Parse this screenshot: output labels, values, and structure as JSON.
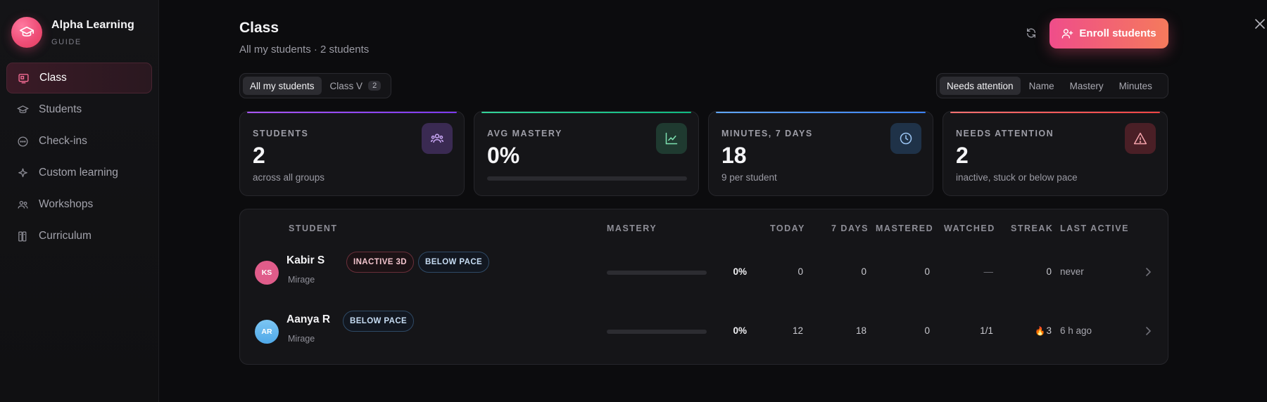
{
  "brand": {
    "name": "Alpha Learning",
    "subtitle": "GUIDE"
  },
  "nav": [
    {
      "label": "Class",
      "icon": "class-icon",
      "active": true
    },
    {
      "label": "Students",
      "icon": "graduation-cap-icon",
      "active": false
    },
    {
      "label": "Check-ins",
      "icon": "chat-bubble-icon",
      "active": false
    },
    {
      "label": "Custom learning",
      "icon": "sparkle-icon",
      "active": false
    },
    {
      "label": "Workshops",
      "icon": "people-icon",
      "active": false
    },
    {
      "label": "Curriculum",
      "icon": "book-icon",
      "active": false
    }
  ],
  "header": {
    "title": "Class",
    "subtitle": "All my students · 2 students",
    "enroll_label": "Enroll students"
  },
  "group_filter": [
    {
      "label": "All my students",
      "active": true
    },
    {
      "label": "Class V",
      "count": "2",
      "active": false
    }
  ],
  "sort_filter": [
    {
      "label": "Needs attention",
      "active": true
    },
    {
      "label": "Name",
      "active": false
    },
    {
      "label": "Mastery",
      "active": false
    },
    {
      "label": "Minutes",
      "active": false
    }
  ],
  "stats": [
    {
      "label": "STUDENTS",
      "value": "2",
      "note": "across all groups",
      "accent": "#a855f7",
      "icon": "group-icon"
    },
    {
      "label": "AVG MASTERY",
      "value": "0%",
      "progress": 0,
      "accent": "#34d399",
      "icon": "trend-chart-icon"
    },
    {
      "label": "MINUTES, 7 DAYS",
      "value": "18",
      "note": "9 per student",
      "accent": "#60a5fa",
      "icon": "clock-icon"
    },
    {
      "label": "NEEDS ATTENTION",
      "value": "2",
      "note": "inactive, stuck or below pace",
      "accent": "#f87171",
      "icon": "warning-icon"
    }
  ],
  "table": {
    "headers": {
      "student": "STUDENT",
      "mastery": "MASTERY",
      "today": "TODAY",
      "days7": "7 DAYS",
      "mastered": "MASTERED",
      "watched": "WATCHED",
      "streak": "STREAK",
      "last_active": "LAST ACTIVE"
    },
    "rows": [
      {
        "initials": "KS",
        "name": "Kabir S",
        "group": "Mirage",
        "badges": [
          {
            "label": "INACTIVE 3D",
            "tone": "red"
          },
          {
            "label": "BELOW PACE",
            "tone": "blue"
          }
        ],
        "mastery": "0%",
        "mastery_progress": 0,
        "today": "0",
        "days7": "0",
        "mastered": "0",
        "watched": "—",
        "streak": "0",
        "last_active": "never",
        "avatar_color": "#e05c8a"
      },
      {
        "initials": "AR",
        "name": "Aanya R",
        "group": "Mirage",
        "badges": [
          {
            "label": "BELOW PACE",
            "tone": "blue"
          }
        ],
        "mastery": "0%",
        "mastery_progress": 0,
        "today": "12",
        "days7": "18",
        "mastered": "0",
        "watched": "1/1",
        "streak": "3",
        "streak_icon": "flame-icon",
        "last_active": "6 h ago",
        "avatar_color": "#5fb4ea"
      }
    ]
  }
}
